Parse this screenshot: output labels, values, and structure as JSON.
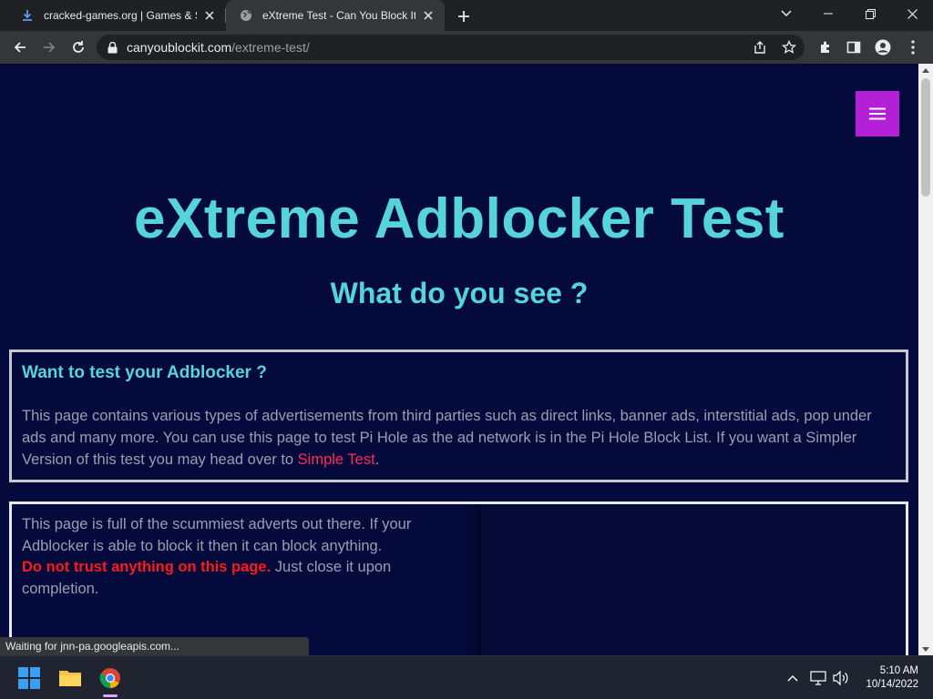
{
  "browser": {
    "tabs": [
      {
        "title": "cracked-games.org | Games & So",
        "favicon": "download-icon"
      },
      {
        "title": "eXtreme Test - Can You Block It ?",
        "favicon": "globe-icon"
      }
    ],
    "url_host": "canyoublockit.com",
    "url_path": "/extreme-test/",
    "status": "Waiting for jnn-pa.googleapis.com..."
  },
  "page": {
    "title": "eXtreme Adblocker Test",
    "subtitle": "What do you see ?",
    "card1": {
      "heading": "Want to test your Adblocker ?",
      "body": "This page contains various types of advertisements from third parties such as direct links, banner ads, interstitial ads, pop under ads and many more. You can use this page to test Pi Hole as the ad network is in the Pi Hole Block List. If you want a Simpler Version of this test you may head over to ",
      "link": "Simple Test",
      "end": "."
    },
    "card2": {
      "text1": "This page is full of the scummiest adverts out there. If your Adblocker is able to block it then it can block anything.",
      "warning": "Do not trust anything on this page.",
      "text2": " Just close it upon completion."
    }
  },
  "taskbar": {
    "time": "5:10 AM",
    "date": "10/14/2022"
  },
  "colors": {
    "page_bg": "#050a3c",
    "heading": "#56d4db",
    "menu_button": "#b41fd8",
    "link": "#ff2d54",
    "warning": "#ff1a1a"
  }
}
